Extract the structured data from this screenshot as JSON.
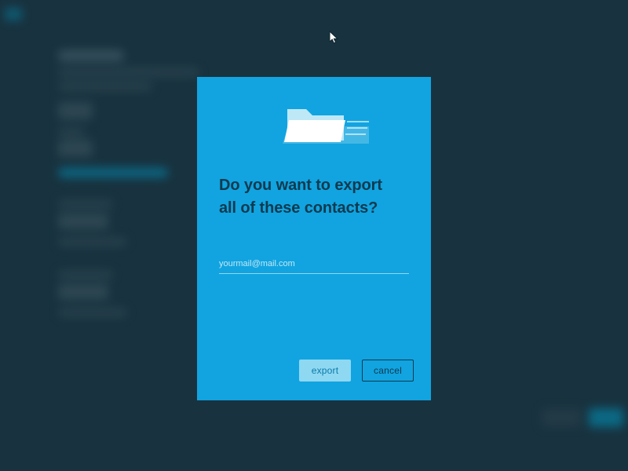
{
  "modal": {
    "title_line1": "Do you want to export",
    "title_line2": "all of these contacts?",
    "email_placeholder": "yourmail@mail.com",
    "email_value": "",
    "export_label": "export",
    "cancel_label": "cancel"
  },
  "colors": {
    "modal_bg": "#11a4e0",
    "modal_text": "#0e3a4f",
    "primary_btn_bg": "#8fd8f2",
    "primary_btn_text": "#0a7aa8",
    "page_bg": "#18323f"
  }
}
